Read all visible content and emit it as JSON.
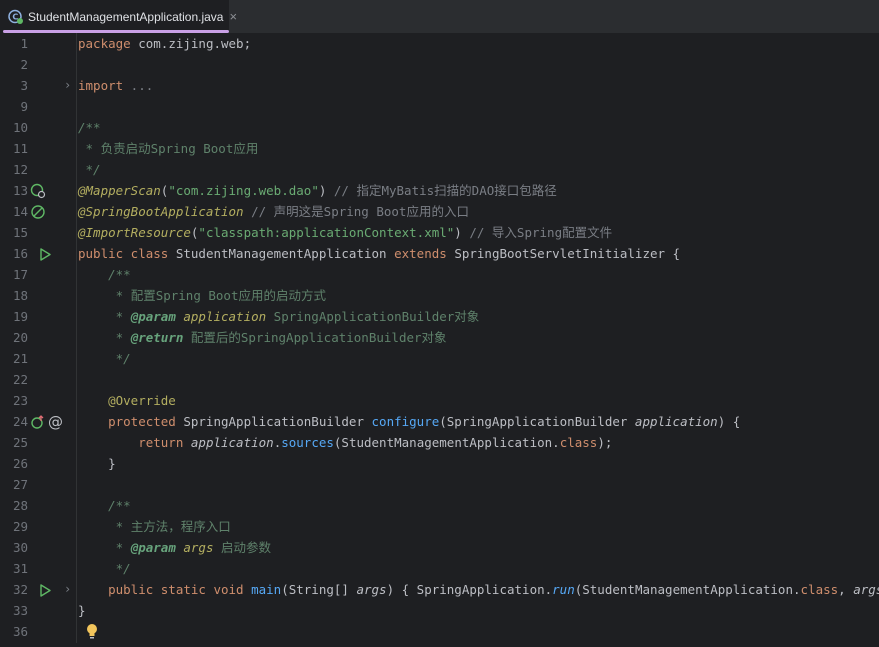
{
  "tab": {
    "title": "StudentManagementApplication.java",
    "close": "×"
  },
  "lines": {
    "n1": "1",
    "n2": "2",
    "n3": "3",
    "n9": "9",
    "n10": "10",
    "n11": "11",
    "n12": "12",
    "n13": "13",
    "n14": "14",
    "n15": "15",
    "n16": "16",
    "n17": "17",
    "n18": "18",
    "n19": "19",
    "n20": "20",
    "n21": "21",
    "n22": "22",
    "n23": "23",
    "n24": "24",
    "n25": "25",
    "n26": "26",
    "n27": "27",
    "n28": "28",
    "n29": "29",
    "n30": "30",
    "n31": "31",
    "n32": "32",
    "n33": "33",
    "n36": "36"
  },
  "code": {
    "l1_kw": "package",
    "l1_rest": " com.zijing.web;",
    "l3_kw": "import",
    "l3_fold": " ...",
    "l10": "/**",
    "l11_star": " * ",
    "l11_txt": "负责启动Spring Boot应用",
    "l12": " */",
    "l13_ann": "@MapperScan",
    "l13_p1": "(",
    "l13_str": "\"com.zijing.web.dao\"",
    "l13_p2": ") ",
    "l13_cmt": "// 指定MyBatis扫描的DAO接口包路径",
    "l14_ann": "@SpringBootApplication",
    "l14_cmt": " // 声明这是Spring Boot应用的入口",
    "l15_ann": "@ImportResource",
    "l15_p1": "(",
    "l15_str": "\"classpath:applicationContext.xml\"",
    "l15_p2": ") ",
    "l15_cmt": "// 导入Spring配置文件",
    "l16_kw1": "public class ",
    "l16_cls": "StudentManagementApplication ",
    "l16_kw2": "extends ",
    "l16_cls2": "SpringBootServletInitializer {",
    "l17": "    /**",
    "l18_star": "     * ",
    "l18_txt": "配置Spring Boot应用的启动方式",
    "l19_star": "     * ",
    "l19_tag": "@param",
    "l19_p": " application",
    "l19_txt": " SpringApplicationBuilder对象",
    "l20_star": "     * ",
    "l20_tag": "@return",
    "l20_txt": " 配置后的SpringApplicationBuilder对象",
    "l21": "     */",
    "l23_ann": "    @Override",
    "l24_kw": "    protected ",
    "l24_cls": "SpringApplicationBuilder ",
    "l24_fn": "configure",
    "l24_p1": "(SpringApplicationBuilder ",
    "l24_param": "application",
    "l24_p2": ") {",
    "l25_kw": "        return ",
    "l25_obj": "application",
    "l25_dot": ".",
    "l25_fn": "sources",
    "l25_p1": "(StudentManagementApplication.",
    "l25_kw2": "class",
    "l25_p2": ");",
    "l26": "    }",
    "l28": "    /**",
    "l29_star": "     * ",
    "l29_txt": "主方法，程序入口",
    "l30_star": "     * ",
    "l30_tag": "@param",
    "l30_p": " args",
    "l30_txt": " 启动参数",
    "l31": "     */",
    "l32_kw": "    public static void ",
    "l32_fn": "main",
    "l32_p1": "(String[] ",
    "l32_param": "args",
    "l32_p2": ") { SpringApplication.",
    "l32_fn2": "run",
    "l32_p3": "(StudentManagementApplication.",
    "l32_kw2": "class",
    "l32_p4": ", ",
    "l32_param2": "args",
    "l32_p5": "); }",
    "l33": "}"
  },
  "icons": {
    "tab": "spring-class-icon",
    "l13": "mybatis-mapper-icon",
    "l14": "spring-boot-icon",
    "l16": "run-icon",
    "l24a": "override-icon",
    "l24b": "spring-bean-icon",
    "l32": "run-icon",
    "l36": "lightbulb-icon"
  },
  "colors": {
    "accent_tab_underline": "#c9a0e6",
    "run_icon": "#5fb865",
    "lightbulb": "#f2c55c"
  }
}
